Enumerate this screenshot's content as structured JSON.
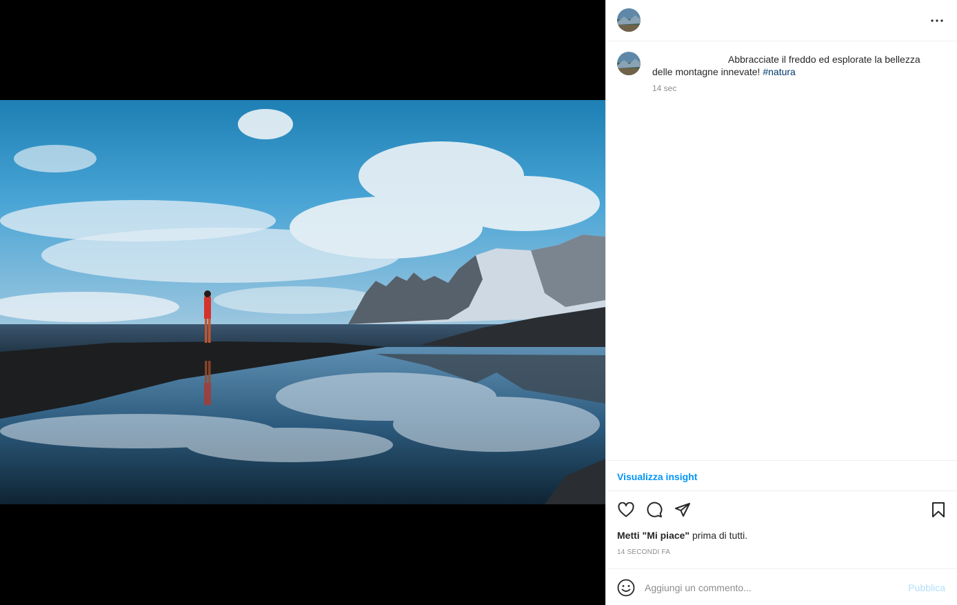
{
  "post": {
    "caption_text": "Abbracciate il freddo ed esplorate la bellezza delle montagne innevate!",
    "hashtag": "#natura",
    "time_short": "14 sec"
  },
  "header": {
    "more_icon": "more-horizontal-icon"
  },
  "insights": {
    "label": "Visualizza insight"
  },
  "actions": {
    "icons": [
      "heart-icon",
      "comment-icon",
      "share-icon",
      "bookmark-icon"
    ]
  },
  "likes": {
    "bold": "Metti \"Mi piace\"",
    "rest": " prima di tutti."
  },
  "timestamp": "14 SECONDI FA",
  "comment": {
    "placeholder": "Aggiungi un commento...",
    "publish_label": "Pubblica",
    "emoji_icon": "emoji-icon"
  },
  "colors": {
    "link": "#0095f6",
    "hashtag": "#00376b",
    "publish_disabled": "#b2dffc",
    "muted": "#8e8e8e"
  }
}
